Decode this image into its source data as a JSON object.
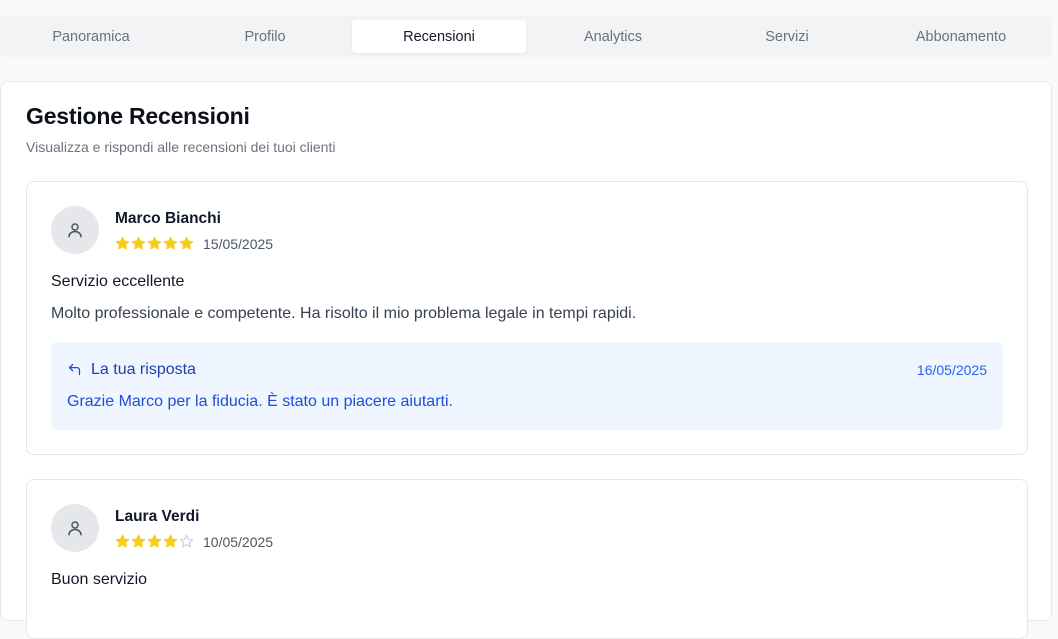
{
  "tabs": [
    {
      "label": "Panoramica",
      "active": false
    },
    {
      "label": "Profilo",
      "active": false
    },
    {
      "label": "Recensioni",
      "active": true
    },
    {
      "label": "Analytics",
      "active": false
    },
    {
      "label": "Servizi",
      "active": false
    },
    {
      "label": "Abbonamento",
      "active": false
    }
  ],
  "page": {
    "title": "Gestione Recensioni",
    "subtitle": "Visualizza e rispondi alle recensioni dei tuoi clienti"
  },
  "reviews": [
    {
      "author": "Marco Bianchi",
      "rating": 5,
      "max_rating": 5,
      "date": "15/05/2025",
      "title": "Servizio eccellente",
      "text": "Molto professionale e competente. Ha risolto il mio problema legale in tempi rapidi.",
      "reply": {
        "label": "La tua risposta",
        "date": "16/05/2025",
        "text": "Grazie Marco per la fiducia. È stato un piacere aiutarti."
      }
    },
    {
      "author": "Laura Verdi",
      "rating": 4,
      "max_rating": 5,
      "date": "10/05/2025",
      "title": "Buon servizio"
    }
  ],
  "colors": {
    "star_filled": "#facc15",
    "star_empty": "#d1d5db",
    "reply_bg": "#eff6ff",
    "reply_text": "#1d4ed8"
  },
  "icons": {
    "avatar": "user-icon",
    "reply": "reply-arrow-icon",
    "star": "star-icon"
  }
}
